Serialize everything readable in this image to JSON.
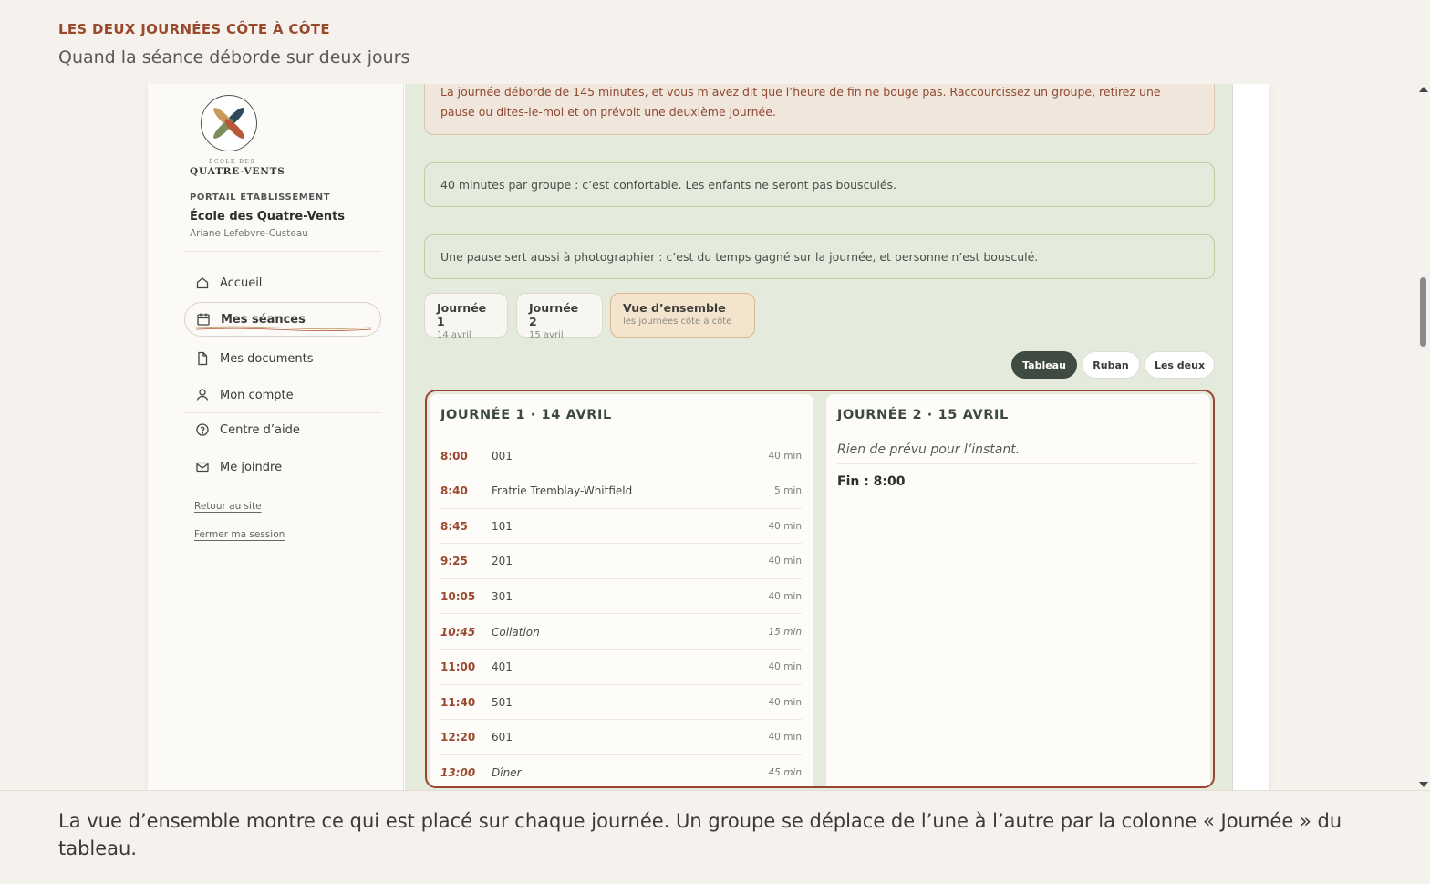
{
  "caption_top": {
    "kicker": "LES DEUX JOURNÉES CÔTE À CÔTE",
    "subtitle": "Quand la séance déborde sur deux jours"
  },
  "caption_bottom": {
    "text": "La vue d’ensemble montre ce qui est placé sur chaque journée. Un groupe se déplace de l’une à l’autre par la colonne « Journée » du tableau."
  },
  "sidebar": {
    "logo_small": "ÉCOLE DES",
    "logo_name": "QUATRE-VENTS",
    "portal_label": "PORTAIL ÉTABLISSEMENT",
    "school_name": "École des Quatre-Vents",
    "user_name": "Ariane Lefebvre-Custeau",
    "items": [
      {
        "label": "Accueil",
        "icon": "home-icon"
      },
      {
        "label": "Mes séances",
        "icon": "calendar-icon",
        "active": true
      },
      {
        "label": "Mes documents",
        "icon": "document-icon"
      },
      {
        "label": "Mon compte",
        "icon": "user-icon"
      },
      {
        "label": "Centre d’aide",
        "icon": "help-icon"
      },
      {
        "label": "Me joindre",
        "icon": "mail-icon"
      }
    ],
    "links": {
      "back": "Retour au site",
      "logout": "Fermer ma session"
    }
  },
  "alerts": {
    "warning": "La journée déborde de 145 minutes, et vous m’avez dit que l’heure de fin ne bouge pas. Raccourcissez un groupe, retirez une pause ou dites-le-moi et on prévoit une deuxième journée.",
    "info1": "40 minutes par groupe : c’est confortable. Les enfants ne seront pas bousculés.",
    "info2": "Une pause sert aussi à photographier : c’est du temps gagné sur la journée, et personne n’est bousculé."
  },
  "day_tabs": [
    {
      "title": "Journée 1",
      "date": "14 avril"
    },
    {
      "title": "Journée 2",
      "date": "15 avril"
    },
    {
      "title": "Vue d’ensemble",
      "date": "les journées côte à côte",
      "active": true
    }
  ],
  "view_toggle": {
    "options": [
      "Tableau",
      "Ruban",
      "Les deux"
    ],
    "selected": "Tableau"
  },
  "day1": {
    "title": "JOURNÉE 1 · 14 AVRIL",
    "rows": [
      {
        "time": "8:00",
        "name": "001",
        "duration": "40 min"
      },
      {
        "time": "8:40",
        "name": "Fratrie Tremblay-Whitfield",
        "duration": "5 min"
      },
      {
        "time": "8:45",
        "name": "101",
        "duration": "40 min"
      },
      {
        "time": "9:25",
        "name": "201",
        "duration": "40 min"
      },
      {
        "time": "10:05",
        "name": "301",
        "duration": "40 min"
      },
      {
        "time": "10:45",
        "name": "Collation",
        "duration": "15 min",
        "break": true
      },
      {
        "time": "11:00",
        "name": "401",
        "duration": "40 min"
      },
      {
        "time": "11:40",
        "name": "501",
        "duration": "40 min"
      },
      {
        "time": "12:20",
        "name": "601",
        "duration": "40 min"
      },
      {
        "time": "13:00",
        "name": "Dîner",
        "duration": "45 min",
        "break": true
      }
    ]
  },
  "day2": {
    "title": "JOURNÉE 2 · 15 AVRIL",
    "empty_text": "Rien de prévu pour l’instant.",
    "end_text": "Fin : 8:00"
  },
  "colors": {
    "accent_rust": "#9b4433",
    "sage_bg": "#e4eadc",
    "dark_green": "#3f4a40"
  }
}
